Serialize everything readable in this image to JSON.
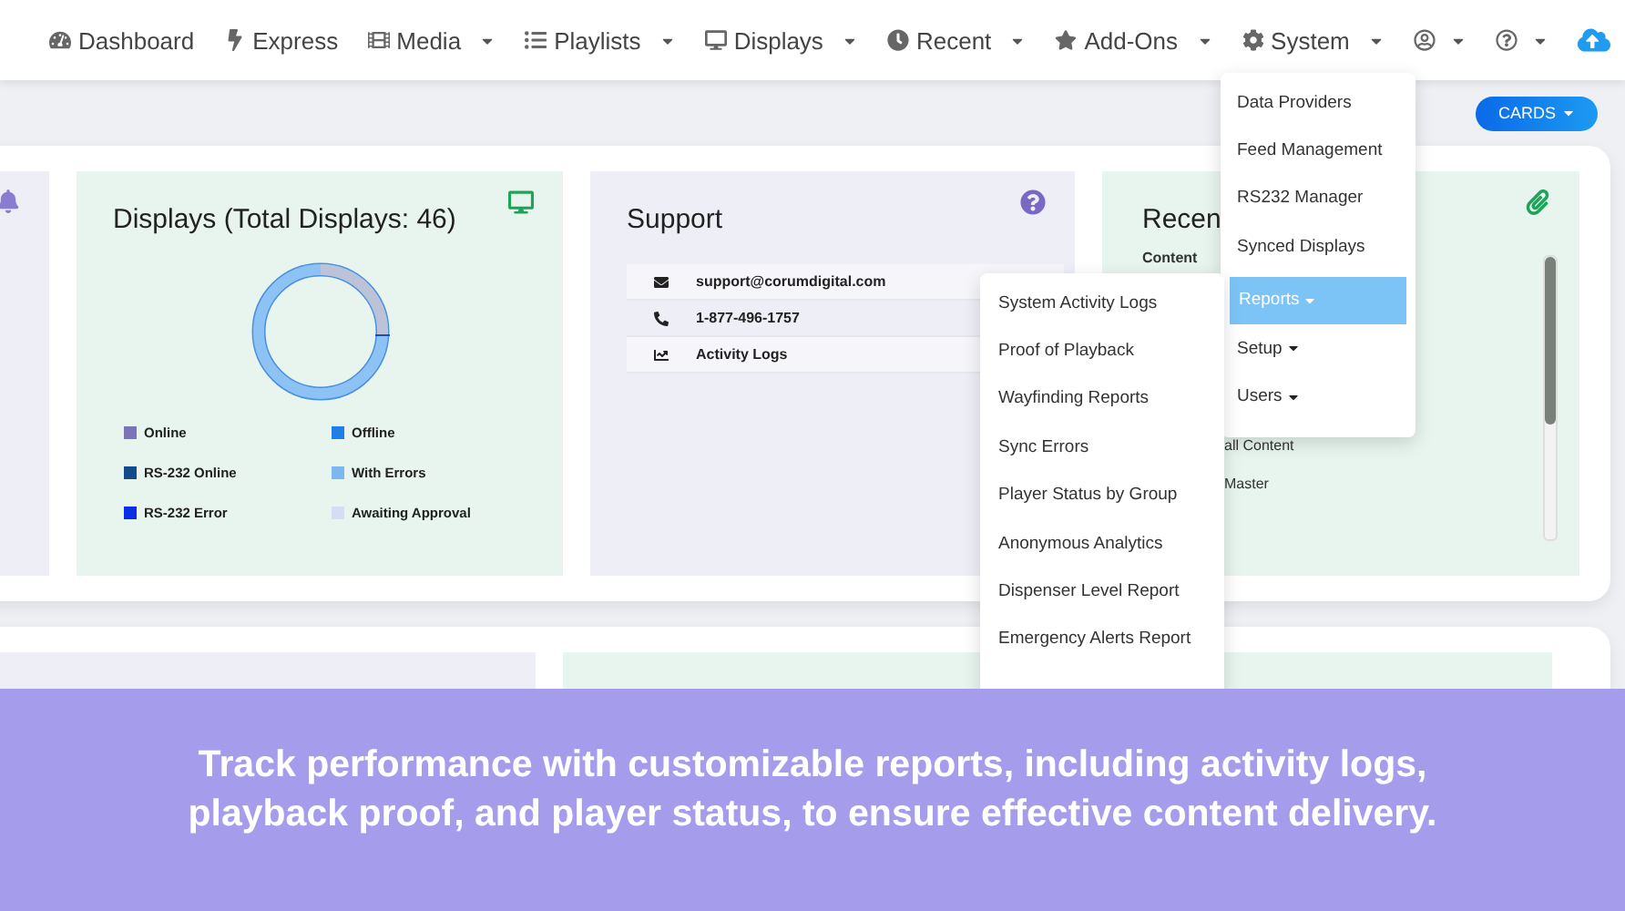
{
  "nav": {
    "items": [
      {
        "label": "Dashboard",
        "caret": false
      },
      {
        "label": "Express",
        "caret": false
      },
      {
        "label": "Media",
        "caret": true
      },
      {
        "label": "Playlists",
        "caret": true
      },
      {
        "label": "Displays",
        "caret": true
      },
      {
        "label": "Recent",
        "caret": true
      },
      {
        "label": "Add-Ons",
        "caret": true
      },
      {
        "label": "System",
        "caret": true
      },
      {
        "caret": true
      },
      {
        "caret": true
      },
      {
        "caret": false
      }
    ]
  },
  "cards_button": "CARDS",
  "displays_card": {
    "title": "Displays (Total Displays: 46)",
    "legend": [
      {
        "label": "Online",
        "color": "#7b74b8"
      },
      {
        "label": "Offline",
        "color": "#1e7fe8"
      },
      {
        "label": "RS-232 Online",
        "color": "#124a8c"
      },
      {
        "label": "With Errors",
        "color": "#7bb8f0"
      },
      {
        "label": "RS-232 Error",
        "color": "#0a2ee6"
      },
      {
        "label": "Awaiting Approval",
        "color": "#d3def3"
      }
    ]
  },
  "support_card": {
    "title": "Support",
    "rows": [
      {
        "text": "support@corumdigital.com"
      },
      {
        "text": "1-877-496-1757"
      },
      {
        "text": "Activity Logs"
      }
    ]
  },
  "recent_card": {
    "title": "Recen",
    "column": "Content",
    "items": [
      "all Content",
      "Master"
    ]
  },
  "system_menu": {
    "items": [
      {
        "label": "Data Providers",
        "submenu": false,
        "selected": false
      },
      {
        "label": "Feed Management",
        "submenu": false,
        "selected": false
      },
      {
        "label": "RS232 Manager",
        "submenu": false,
        "selected": false
      },
      {
        "label": "Synced Displays",
        "submenu": false,
        "selected": false
      },
      {
        "label": "Reports",
        "submenu": true,
        "selected": true
      },
      {
        "label": "Setup",
        "submenu": true,
        "selected": false
      },
      {
        "label": "Users",
        "submenu": true,
        "selected": false
      }
    ]
  },
  "reports_menu": {
    "items": [
      "System Activity Logs",
      "Proof of Playback",
      "Wayfinding Reports",
      "Sync Errors",
      "Player Status by Group",
      "Anonymous Analytics",
      "Dispenser Level Report",
      "Emergency Alerts Report"
    ]
  },
  "banner": "Track performance with customizable reports, including activity logs, playback proof, and player status, to ensure effective content delivery."
}
